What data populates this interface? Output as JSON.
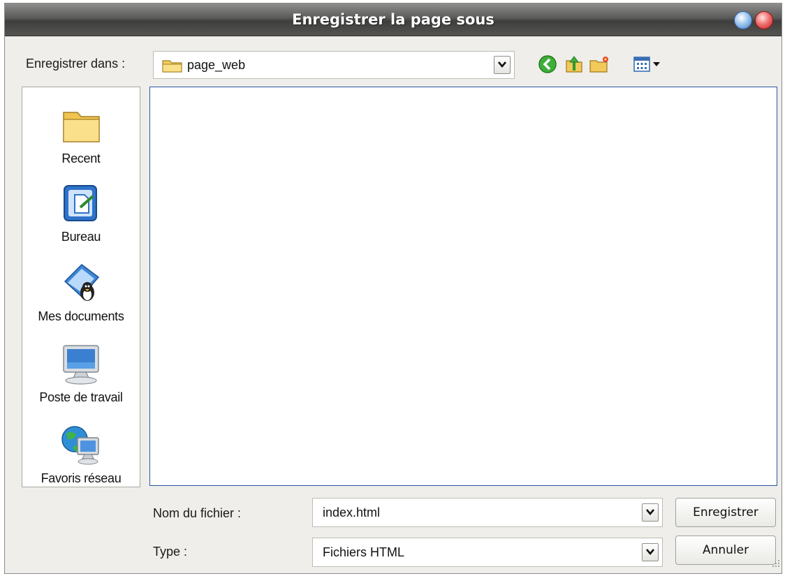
{
  "window": {
    "title": "Enregistrer la page sous"
  },
  "toolbar": {
    "save_in_label": "Enregistrer dans :",
    "current_folder": "page_web",
    "current_folder_icon": "folder-icon",
    "back_icon": "back-arrow-icon",
    "up_icon": "up-folder-icon",
    "new_folder_icon": "new-folder-icon",
    "views_icon": "view-menu-icon"
  },
  "places": [
    {
      "label": "Recent",
      "icon": "recent-folder-icon"
    },
    {
      "label": "Bureau",
      "icon": "desktop-icon"
    },
    {
      "label": "Mes documents",
      "icon": "my-documents-icon"
    },
    {
      "label": "Poste de travail",
      "icon": "my-computer-icon"
    },
    {
      "label": "Favoris réseau",
      "icon": "network-places-icon"
    }
  ],
  "form": {
    "filename_label": "Nom du fichier :",
    "filename_value": "index.html",
    "type_label": "Type :",
    "type_value": "Fichiers HTML"
  },
  "buttons": {
    "save": "Enregistrer",
    "cancel": "Annuler"
  },
  "colors": {
    "accent": "#2b58a4",
    "window_bg": "#efeeea"
  }
}
